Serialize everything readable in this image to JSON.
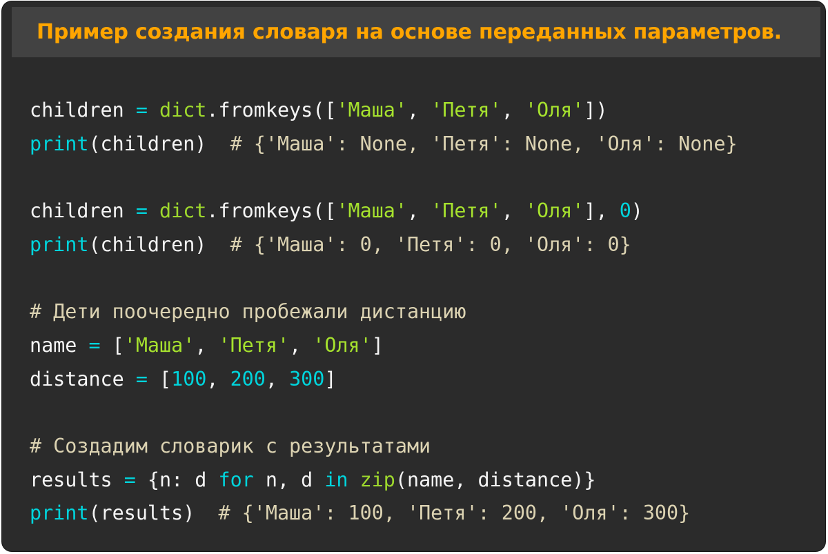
{
  "title": "Пример создания словаря на основе переданных параметров.",
  "colors": {
    "title": "#ffa500",
    "background": "#2b2b2b",
    "title_bar": "#424242",
    "plain": "#f5f5f5",
    "operator": "#00d4dc",
    "builtin": "#9ed82d",
    "string": "#a6e22e",
    "number": "#00d4dc",
    "comment": "#dcd3b2"
  },
  "code_lines": [
    [
      [
        "plain",
        "children "
      ],
      [
        "op",
        "="
      ],
      [
        "plain",
        " "
      ],
      [
        "builtin",
        "dict"
      ],
      [
        "plain",
        ".fromkeys(["
      ],
      [
        "str",
        "'Маша'"
      ],
      [
        "plain",
        ", "
      ],
      [
        "str",
        "'Петя'"
      ],
      [
        "plain",
        ", "
      ],
      [
        "str",
        "'Оля'"
      ],
      [
        "plain",
        "])"
      ]
    ],
    [
      [
        "print",
        "print"
      ],
      [
        "plain",
        "(children)  "
      ],
      [
        "comment",
        "# {'Маша': None, 'Петя': None, 'Оля': None}"
      ]
    ],
    [],
    [
      [
        "plain",
        "children "
      ],
      [
        "op",
        "="
      ],
      [
        "plain",
        " "
      ],
      [
        "builtin",
        "dict"
      ],
      [
        "plain",
        ".fromkeys(["
      ],
      [
        "str",
        "'Маша'"
      ],
      [
        "plain",
        ", "
      ],
      [
        "str",
        "'Петя'"
      ],
      [
        "plain",
        ", "
      ],
      [
        "str",
        "'Оля'"
      ],
      [
        "plain",
        "], "
      ],
      [
        "num",
        "0"
      ],
      [
        "plain",
        ")"
      ]
    ],
    [
      [
        "print",
        "print"
      ],
      [
        "plain",
        "(children)  "
      ],
      [
        "comment",
        "# {'Маша': 0, 'Петя': 0, 'Оля': 0}"
      ]
    ],
    [],
    [
      [
        "comment",
        "# Дети поочередно пробежали дистанцию"
      ]
    ],
    [
      [
        "plain",
        "name "
      ],
      [
        "op",
        "="
      ],
      [
        "plain",
        " ["
      ],
      [
        "str",
        "'Маша'"
      ],
      [
        "plain",
        ", "
      ],
      [
        "str",
        "'Петя'"
      ],
      [
        "plain",
        ", "
      ],
      [
        "str",
        "'Оля'"
      ],
      [
        "plain",
        "]"
      ]
    ],
    [
      [
        "plain",
        "distance "
      ],
      [
        "op",
        "="
      ],
      [
        "plain",
        " ["
      ],
      [
        "num",
        "100"
      ],
      [
        "plain",
        ", "
      ],
      [
        "num",
        "200"
      ],
      [
        "plain",
        ", "
      ],
      [
        "num",
        "300"
      ],
      [
        "plain",
        "]"
      ]
    ],
    [],
    [
      [
        "comment",
        "# Создадим словарик с результатами"
      ]
    ],
    [
      [
        "plain",
        "results "
      ],
      [
        "op",
        "="
      ],
      [
        "plain",
        " {n: d "
      ],
      [
        "kw",
        "for"
      ],
      [
        "plain",
        " n, d "
      ],
      [
        "kw",
        "in"
      ],
      [
        "plain",
        " "
      ],
      [
        "builtin",
        "zip"
      ],
      [
        "plain",
        "(name, distance)}"
      ]
    ],
    [
      [
        "print",
        "print"
      ],
      [
        "plain",
        "(results)  "
      ],
      [
        "comment",
        "# {'Маша': 100, 'Петя': 200, 'Оля': 300}"
      ]
    ]
  ]
}
